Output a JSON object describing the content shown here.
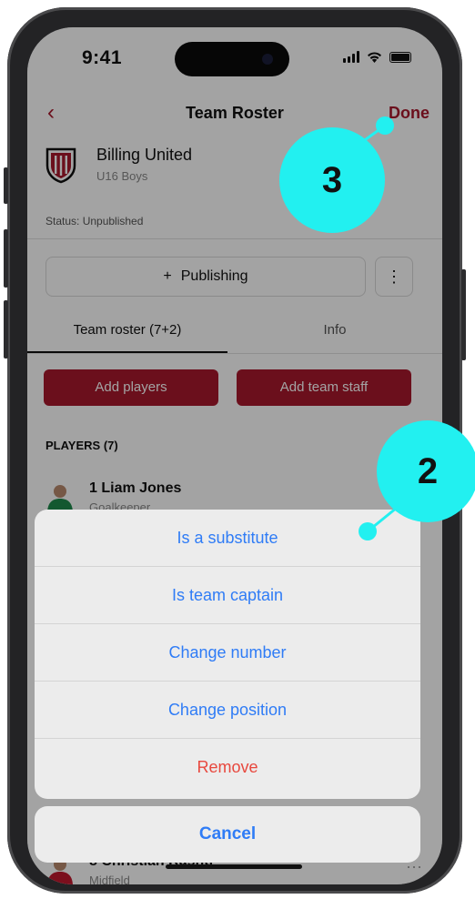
{
  "status_bar": {
    "time": "9:41"
  },
  "nav": {
    "back": "‹",
    "title": "Team Roster",
    "done": "Done"
  },
  "team": {
    "name": "Billing United",
    "subtitle": "U16 Boys",
    "status": "Status: Unpublished"
  },
  "publishing": {
    "plus": "+",
    "label": "Publishing",
    "more": "⋮"
  },
  "tabs": [
    {
      "label": "Team roster (7+2)",
      "active": true
    },
    {
      "label": "Info",
      "active": false
    }
  ],
  "actions": {
    "add_players": "Add players",
    "add_staff": "Add team staff"
  },
  "players_section": "PLAYERS (7)",
  "players": [
    {
      "name": "1 Liam Jones",
      "position": "Goalkeeper"
    },
    {
      "name": "8 Christian Rashti",
      "position": "Midfield"
    }
  ],
  "player_more": "···",
  "action_sheet": {
    "items": [
      {
        "label": "Is a substitute"
      },
      {
        "label": "Is team captain"
      },
      {
        "label": "Change number"
      },
      {
        "label": "Change position"
      },
      {
        "label": "Remove",
        "destructive": true
      }
    ],
    "cancel": "Cancel"
  },
  "callouts": [
    {
      "number": "3"
    },
    {
      "number": "2"
    }
  ],
  "colors": {
    "brand": "#a8182c",
    "ios_blue": "#2f7cf6",
    "destructive": "#e8483e",
    "callout": "#22f0f0"
  }
}
